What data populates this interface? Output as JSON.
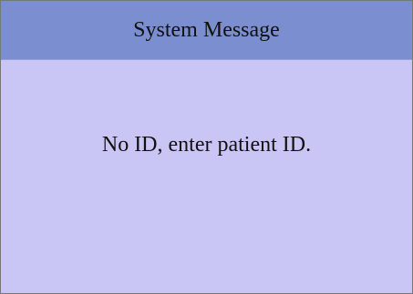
{
  "dialog": {
    "title": "System Message",
    "message": "No ID, enter patient ID.",
    "colors": {
      "titlebar": "#7b8fd0",
      "body": "#c9c6f5",
      "text": "#111111"
    }
  }
}
